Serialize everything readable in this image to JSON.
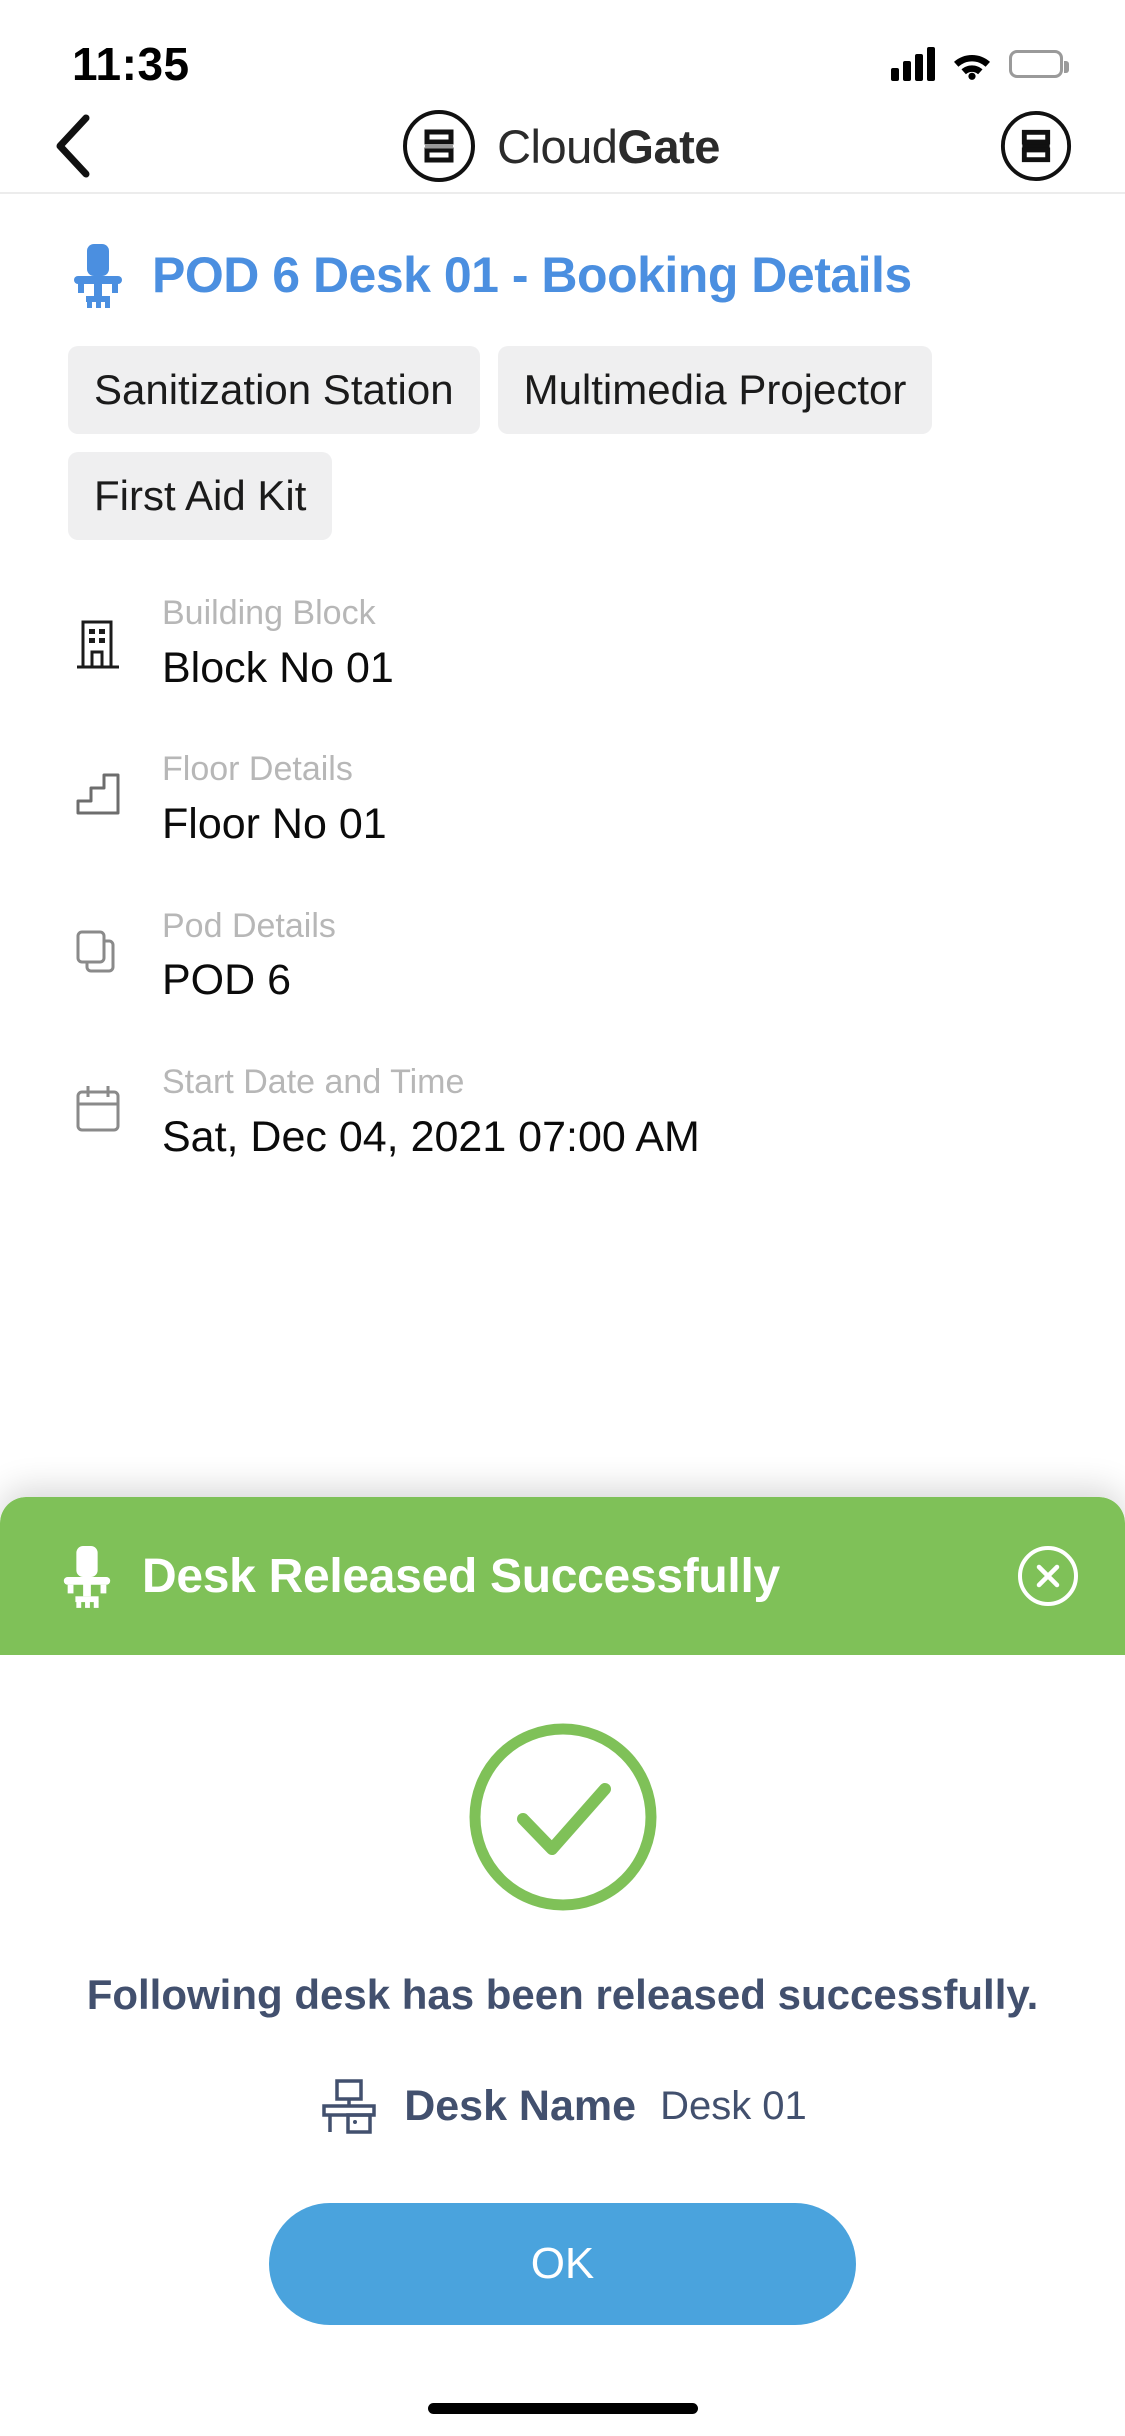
{
  "status_bar": {
    "time": "11:35",
    "signal_icon": "cellular-bars-icon",
    "wifi_icon": "wifi-icon",
    "battery_icon": "battery-icon",
    "battery_color": "#f5c542"
  },
  "nav": {
    "back_icon": "chevron-left-icon",
    "brand_icon": "cloudgate-logo-icon",
    "brand_first": "Cloud",
    "brand_second": "Gate",
    "menu_icon": "cloudgate-menu-icon"
  },
  "page": {
    "title_icon": "desk-chair-icon",
    "title": "POD 6 Desk 01 - Booking Details",
    "title_color": "#4b8fe0",
    "amenities": [
      "Sanitization Station",
      "Multimedia Projector",
      "First Aid Kit"
    ],
    "details": [
      {
        "icon": "building-icon",
        "label": "Building Block",
        "value": "Block No 01"
      },
      {
        "icon": "stairs-icon",
        "label": "Floor Details",
        "value": "Floor No 01"
      },
      {
        "icon": "pod-layers-icon",
        "label": "Pod Details",
        "value": "POD 6"
      },
      {
        "icon": "calendar-icon",
        "label": "Start Date and Time",
        "value": "Sat, Dec 04, 2021 07:00 AM"
      }
    ]
  },
  "sheet": {
    "banner_color": "#7fc158",
    "banner_icon": "desk-chair-icon",
    "banner_title": "Desk Released Successfully",
    "close_icon": "close-circle-icon",
    "success_icon": "check-circle-icon",
    "success_color": "#7fc158",
    "message": "Following desk has been released successfully.",
    "desk_icon": "desk-monitor-icon",
    "desk_label": "Desk Name",
    "desk_value": "Desk 01",
    "ok_label": "OK",
    "ok_color": "#4aa3dd"
  }
}
